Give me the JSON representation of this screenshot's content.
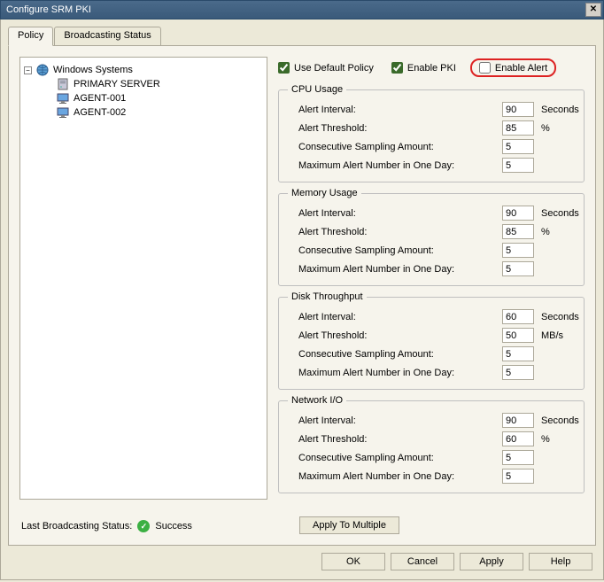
{
  "window": {
    "title": "Configure SRM PKI"
  },
  "tabs": {
    "policy": "Policy",
    "broadcasting": "Broadcasting Status"
  },
  "tree": {
    "root": "Windows Systems",
    "items": [
      "PRIMARY SERVER",
      "AGENT-001",
      "AGENT-002"
    ]
  },
  "checks": {
    "use_default": {
      "label": "Use Default Policy",
      "checked": true
    },
    "enable_pki": {
      "label": "Enable PKI",
      "checked": true
    },
    "enable_alert": {
      "label": "Enable Alert",
      "checked": false
    }
  },
  "groups": [
    {
      "legend": "CPU Usage",
      "rows": [
        {
          "label": "Alert Interval:",
          "value": "90",
          "unit": "Seconds"
        },
        {
          "label": "Alert Threshold:",
          "value": "85",
          "unit": "%"
        },
        {
          "label": "Consecutive Sampling Amount:",
          "value": "5",
          "unit": ""
        },
        {
          "label": "Maximum Alert Number in One Day:",
          "value": "5",
          "unit": ""
        }
      ]
    },
    {
      "legend": "Memory Usage",
      "rows": [
        {
          "label": "Alert Interval:",
          "value": "90",
          "unit": "Seconds"
        },
        {
          "label": "Alert Threshold:",
          "value": "85",
          "unit": "%"
        },
        {
          "label": "Consecutive Sampling Amount:",
          "value": "5",
          "unit": ""
        },
        {
          "label": "Maximum Alert Number in One Day:",
          "value": "5",
          "unit": ""
        }
      ]
    },
    {
      "legend": "Disk Throughput",
      "rows": [
        {
          "label": "Alert Interval:",
          "value": "60",
          "unit": "Seconds"
        },
        {
          "label": "Alert Threshold:",
          "value": "50",
          "unit": "MB/s"
        },
        {
          "label": "Consecutive Sampling Amount:",
          "value": "5",
          "unit": ""
        },
        {
          "label": "Maximum Alert Number in One Day:",
          "value": "5",
          "unit": ""
        }
      ]
    },
    {
      "legend": "Network I/O",
      "rows": [
        {
          "label": "Alert Interval:",
          "value": "90",
          "unit": "Seconds"
        },
        {
          "label": "Alert Threshold:",
          "value": "60",
          "unit": "%"
        },
        {
          "label": "Consecutive Sampling Amount:",
          "value": "5",
          "unit": ""
        },
        {
          "label": "Maximum Alert Number in One Day:",
          "value": "5",
          "unit": ""
        }
      ]
    }
  ],
  "status": {
    "label": "Last Broadcasting Status:",
    "value": "Success"
  },
  "buttons": {
    "apply_multi": "Apply To Multiple",
    "ok": "OK",
    "cancel": "Cancel",
    "apply": "Apply",
    "help": "Help"
  }
}
